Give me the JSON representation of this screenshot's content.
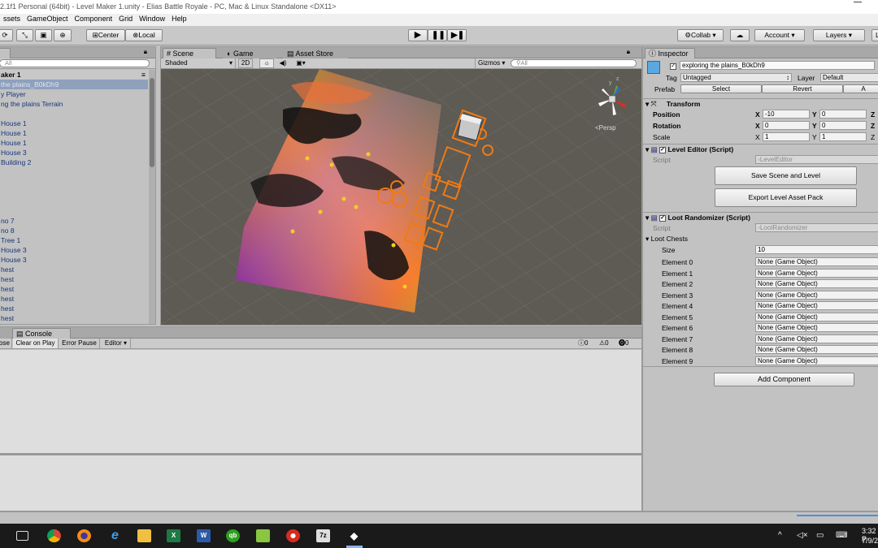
{
  "title_bar": {
    "text": "2.1f1 Personal (64bit) - Level Maker 1.unity - Elias Battle Royale - PC, Mac & Linux Standalone <DX11>"
  },
  "menu": [
    "ssets",
    "GameObject",
    "Component",
    "Grid",
    "Window",
    "Help"
  ],
  "toolbar": {
    "pivot_center": "Center",
    "pivot_local": "Local",
    "collab": "Collab ▾",
    "account": "Account ▾",
    "layers": "Layers ▾",
    "layout": "L"
  },
  "hierarchy": {
    "search_placeholder": "All",
    "scene_name": "aker 1",
    "items": [
      " the plains_B0kDh9",
      "y Player",
      "ng the plains Terrain",
      "House 1",
      "House 1",
      "House 1",
      "House 3",
      " Building 2",
      "no 7",
      "no 8",
      "Tree 1",
      "House 3",
      "House 3",
      "hest",
      "hest",
      "hest",
      "hest",
      "hest",
      "hest",
      "hest"
    ]
  },
  "scene_view": {
    "tabs": {
      "scene": "Scene",
      "game": "Game",
      "asset_store": "Asset Store"
    },
    "shading_mode": "Shaded",
    "mode_2d": "2D",
    "gizmos": "Gizmos ▾",
    "search_placeholder": "All",
    "persp_label": "Persp",
    "gizmo_y": "y",
    "gizmo_z": "z"
  },
  "console": {
    "tab": "Console",
    "buttons": [
      "ose",
      "Clear on Play",
      "Error Pause",
      "Editor ▾"
    ],
    "counts": {
      "info": "0",
      "warn": "0",
      "error": "0"
    }
  },
  "inspector": {
    "tab": "Inspector",
    "object_name": "exploring the plains_B0kDh9",
    "tag_label": "Tag",
    "tag_value": "Untagged",
    "layer_label": "Layer",
    "layer_value": "Default",
    "prefab_label": "Prefab",
    "prefab_buttons": [
      "Select",
      "Revert",
      "A"
    ],
    "transform": {
      "title": "Transform",
      "position_label": "Position",
      "rotation_label": "Rotation",
      "scale_label": "Scale",
      "x_axis": "X",
      "y_axis": "Y",
      "z_axis": "Z",
      "position": {
        "x": "-10",
        "y": "0"
      },
      "rotation": {
        "x": "0",
        "y": "0"
      },
      "scale": {
        "x": "1",
        "y": "1"
      }
    },
    "level_editor": {
      "title": "Level Editor (Script)",
      "script_label": "Script",
      "script_value": "LevelEditor",
      "save_button": "Save Scene and Level",
      "export_button": "Export Level Asset Pack"
    },
    "loot_randomizer": {
      "title": "Loot Randomizer (Script)",
      "script_label": "Script",
      "script_value": "LootRandomizer",
      "loot_chests_label": "Loot Chests",
      "size_label": "Size",
      "size_value": "10",
      "elements": [
        {
          "label": "Element 0",
          "value": "None (Game Object)"
        },
        {
          "label": "Element 1",
          "value": "None (Game Object)"
        },
        {
          "label": "Element 2",
          "value": "None (Game Object)"
        },
        {
          "label": "Element 3",
          "value": "None (Game Object)"
        },
        {
          "label": "Element 4",
          "value": "None (Game Object)"
        },
        {
          "label": "Element 5",
          "value": "None (Game Object)"
        },
        {
          "label": "Element 6",
          "value": "None (Game Object)"
        },
        {
          "label": "Element 7",
          "value": "None (Game Object)"
        },
        {
          "label": "Element 8",
          "value": "None (Game Object)"
        },
        {
          "label": "Element 9",
          "value": "None (Game Object)"
        }
      ]
    },
    "add_component": "Add Component"
  },
  "taskbar": {
    "apps": [
      "task-view",
      "chrome",
      "firefox",
      "internet-explorer",
      "file-explorer",
      "excel",
      "word",
      "quickbooks",
      "notepadpp",
      "chrome-red",
      "7zip",
      "unity"
    ],
    "app_glyphs": {
      "excel": "X",
      "word": "W",
      "quickbooks": "qb",
      "sevenzip": "7z"
    },
    "time": "3:32 P",
    "date": "7/9/2"
  },
  "colors": {
    "editor_bg": "#c2c2c2",
    "scene_bg": "#5e5a54",
    "selection_orange": "#f07a14",
    "hierarchy_text": "#18367a",
    "taskbar_bg": "#1a1a1a"
  }
}
